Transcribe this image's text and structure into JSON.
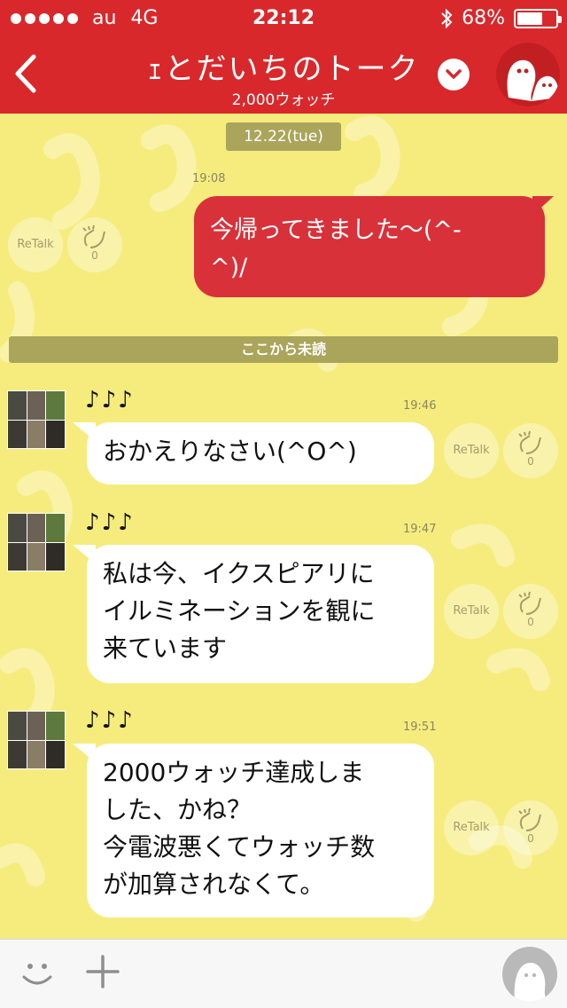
{
  "status_bar": {
    "carrier": "au",
    "network": "4G",
    "time": "22:12",
    "battery": "68%",
    "battery_level": 0.68
  },
  "header": {
    "title": "ｪとだいちのトーク",
    "subtitle": "2,000ウォッチ"
  },
  "chat": {
    "date": "12.22(tue)",
    "outgoing": {
      "time": "19:08",
      "text_line1": "今帰ってきました〜(^-",
      "text_line2": "^)/",
      "retalk": "ReTalk",
      "claps": "0"
    },
    "unread_divider": "ここから未読",
    "messages": [
      {
        "sender": "♪♪♪",
        "time": "19:46",
        "lines": [
          "おかえりなさい(^O^)"
        ],
        "retalk": "ReTalk",
        "claps": "0"
      },
      {
        "sender": "♪♪♪",
        "time": "19:47",
        "lines": [
          "私は今、イクスピアリに",
          "イルミネーションを観に",
          "来ています"
        ],
        "retalk": "ReTalk",
        "claps": "0"
      },
      {
        "sender": "♪♪♪",
        "time": "19:51",
        "lines": [
          "2000ウォッチ達成しま",
          "した、かね？",
          "今電波悪くてウォッチ数",
          "が加算されなくて。"
        ],
        "retalk": "ReTalk",
        "claps": "0"
      }
    ]
  },
  "colors": {
    "header_bg": "#d9282b",
    "chat_bg": "#f6ec7e",
    "outgoing_bubble": "#d9313a",
    "pill": "#aaa55a"
  }
}
